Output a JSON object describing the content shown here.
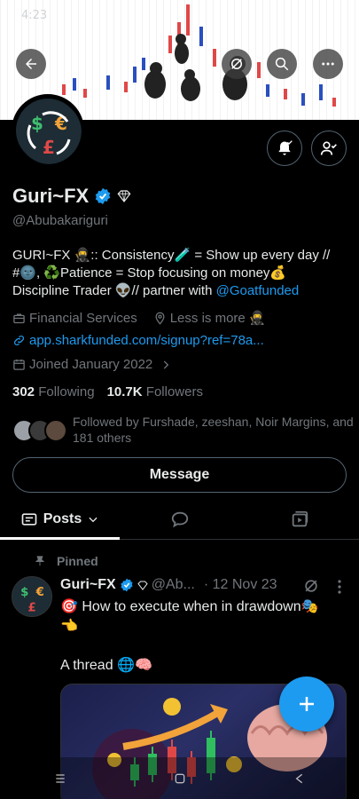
{
  "status_bar": {
    "time": "4:23"
  },
  "profile": {
    "display_name": "Guri~FX",
    "handle": "@Abubakariguri",
    "bio_line1": "GURI~FX 🥷:: Consistency🧪 = Show up every day //",
    "bio_line2": "#🌚, ♻️Patience = Stop focusing on money💰",
    "bio_line3_prefix": "Discipline Trader 👽// partner with ",
    "bio_mention": "@Goatfunded",
    "category": "Financial Services",
    "location": "Less is more 🥷",
    "website": "app.sharkfunded.com/signup?ref=78a...",
    "joined": "Joined January 2022",
    "following_count": "302",
    "following_label": "Following",
    "followers_count": "10.7K",
    "followers_label": "Followers",
    "followed_by": "Followed by Furshade, zeeshan, Noir Margins, and 181 others",
    "message_label": "Message"
  },
  "tabs": [
    {
      "label": "Posts",
      "icon": "posts-icon"
    },
    {
      "label": "",
      "icon": "replies-icon"
    },
    {
      "label": "",
      "icon": "media-icon"
    }
  ],
  "tweet": {
    "pinned_label": "Pinned",
    "name": "Guri~FX",
    "handle": "@Ab...",
    "date": "· 12 Nov 23",
    "line1": "🎯 How to execute when in drawdown🎭",
    "line2": "👈",
    "line3": "A thread 🌐🧠"
  },
  "colors": {
    "accent": "#1d9bf0",
    "background": "#000000",
    "muted_text": "#71767b",
    "border": "#536471"
  }
}
